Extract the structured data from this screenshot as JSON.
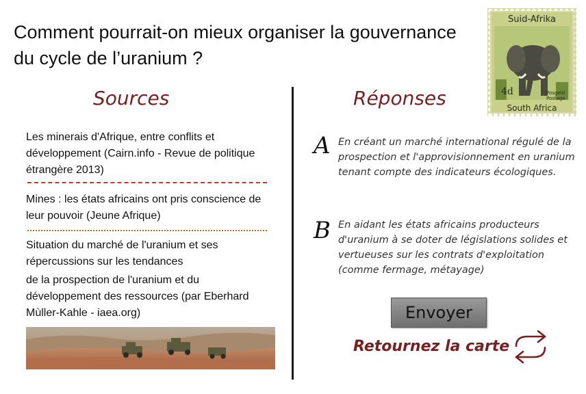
{
  "title": "Comment pourrait-on mieux organiser la gouvernance du cycle de l’uranium ?",
  "stamp": {
    "country_top": "Suid-Afrika",
    "country_bottom": "South Africa",
    "value": "4d",
    "postage_line1": "Posgeld",
    "postage_line2": "Postage"
  },
  "sources": {
    "heading": "Sources",
    "items": [
      {
        "text": "Les minerais d'Afrique, entre conflits et développement (Cairn.info - Revue de politique étrangère 2013)"
      },
      {
        "text": "Mines : les états africains ont pris conscience de leur pouvoir (Jeune Afrique)"
      },
      {
        "text": "Situation du marché de l'uranium et ses répercussions sur les tendances",
        "text_continued": "de la prospection de l'uranium et du développement des ressources (par Eberhard Mùller-Kahle - iaea.org)"
      }
    ]
  },
  "responses": {
    "heading": "Réponses",
    "items": [
      {
        "letter": "A",
        "text": "En créant un marché international régulé de la prospection et l'approvisionnement en uranium tenant compte des indicateurs écologiques."
      },
      {
        "letter": "B",
        "text": "En aidant les états africains producteurs d'uranium à se doter de législations solides et vertueuses sur les contrats d'exploitation (comme fermage, métayage)"
      }
    ]
  },
  "actions": {
    "send_label": "Envoyer",
    "return_label": "Retournez la carte"
  },
  "colors": {
    "accent": "#7a1f1f",
    "separator_1": "#c23a2a",
    "separator_2": "#c86a1a",
    "button": "#7f7f7f"
  },
  "icons": {
    "stamp": "elephant-stamp-icon",
    "photo": "mine-site-photo",
    "flip": "flip-card-icon"
  }
}
